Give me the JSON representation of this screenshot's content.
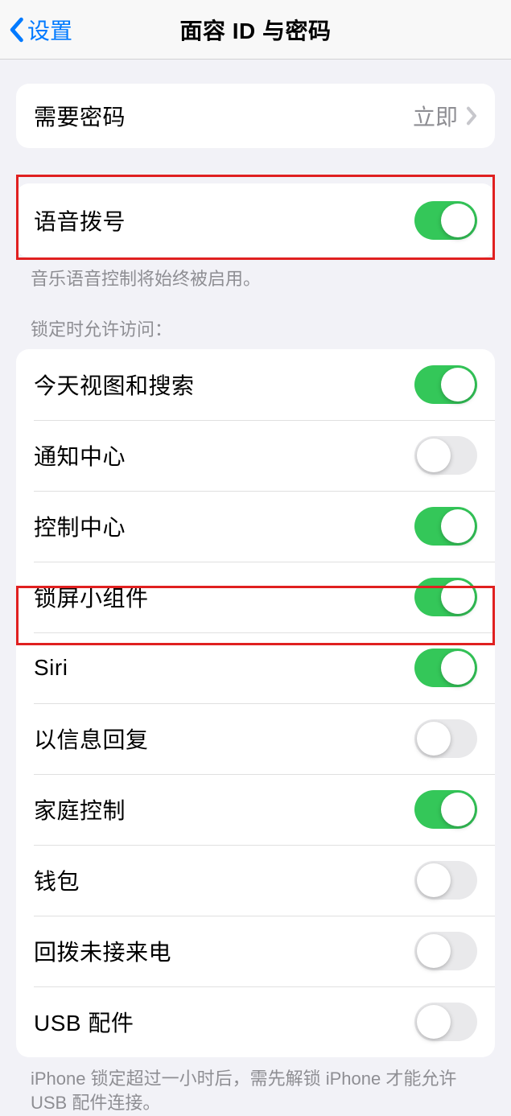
{
  "nav": {
    "back_label": "设置",
    "title": "面容 ID 与密码"
  },
  "passcode_row": {
    "label": "需要密码",
    "value": "立即"
  },
  "voice_dial": {
    "label": "语音拨号",
    "enabled": true,
    "footer": "音乐语音控制将始终被启用。"
  },
  "lock_access": {
    "header": "锁定时允许访问：",
    "items": [
      {
        "label": "今天视图和搜索",
        "enabled": true
      },
      {
        "label": "通知中心",
        "enabled": false
      },
      {
        "label": "控制中心",
        "enabled": true
      },
      {
        "label": "锁屏小组件",
        "enabled": true
      },
      {
        "label": "Siri",
        "enabled": true
      },
      {
        "label": "以信息回复",
        "enabled": false
      },
      {
        "label": "家庭控制",
        "enabled": true
      },
      {
        "label": "钱包",
        "enabled": false
      },
      {
        "label": "回拨未接来电",
        "enabled": false
      },
      {
        "label": "USB 配件",
        "enabled": false
      }
    ],
    "footer": "iPhone 锁定超过一小时后，需先解锁 iPhone 才能允许 USB 配件连接。"
  }
}
